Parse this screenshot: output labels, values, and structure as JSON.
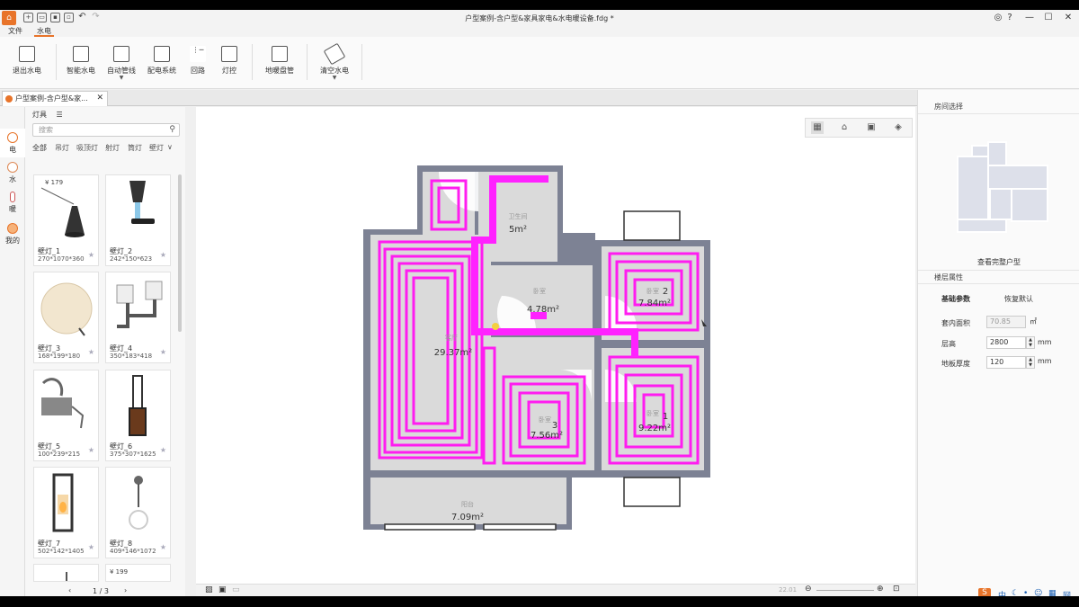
{
  "window": {
    "title": "户型案例-含户型&家具家电&水电暖设备.fdg *",
    "logo": "home-logo-icon",
    "controls": [
      "user-icon",
      "help-icon",
      "minimize-icon",
      "maximize-icon",
      "close-icon"
    ]
  },
  "quick_access": [
    "new-icon",
    "open-icon",
    "save-icon",
    "save-as-icon",
    "undo-icon",
    "redo-icon"
  ],
  "menu": {
    "file": "文件",
    "water_electric": "水电"
  },
  "ribbon": {
    "exit": "退出水电",
    "smart": "智能水电",
    "auto_pipe": "自动管线",
    "distribution": "配电系统",
    "circuit": "回路",
    "light_control": "灯控",
    "floor_heating": "地暖盘管",
    "clear": "清空水电"
  },
  "doc_tab": {
    "label": "户型案例-含户型&家...",
    "close": "✕"
  },
  "vtabs": {
    "electric": "电",
    "water": "水",
    "heating": "暖",
    "mine": "我的"
  },
  "catalog": {
    "header": "灯具",
    "search_placeholder": "搜索",
    "categories": [
      "全部",
      "吊灯",
      "吸顶灯",
      "射灯",
      "筒灯",
      "壁灯"
    ],
    "items": [
      {
        "name": "壁灯_1",
        "size": "270*1070*360",
        "price": "¥ 179"
      },
      {
        "name": "壁灯_2",
        "size": "242*150*623",
        "price": ""
      },
      {
        "name": "壁灯_3",
        "size": "168*199*180",
        "price": ""
      },
      {
        "name": "壁灯_4",
        "size": "350*183*418",
        "price": ""
      },
      {
        "name": "壁灯_5",
        "size": "100*239*215",
        "price": ""
      },
      {
        "name": "壁灯_6",
        "size": "375*307*1625",
        "price": ""
      },
      {
        "name": "壁灯_7",
        "size": "502*142*1405",
        "price": ""
      },
      {
        "name": "壁灯_8",
        "size": "409*146*1072",
        "price": ""
      },
      {
        "name": "",
        "size": "",
        "price": ""
      },
      {
        "name": "",
        "size": "",
        "price": "¥ 199"
      }
    ],
    "pager": "1 / 3"
  },
  "floorplan": {
    "rooms": [
      {
        "label": "卫生间",
        "area": "5m²"
      },
      {
        "label": "卧室",
        "area": "4.78m²"
      },
      {
        "label": "客厅",
        "area": "29.37m²"
      },
      {
        "label": "卧室",
        "area": "7.84m²"
      },
      {
        "label": "卧室",
        "area": "7.56m²"
      },
      {
        "label": "卧室",
        "area": "9.22m²"
      },
      {
        "label": "阳台",
        "area": "7.09m²"
      }
    ],
    "circuit_numbers": [
      "1",
      "2",
      "3"
    ],
    "pipe_color": "#ff1cf0",
    "main_pipe_color": "#ff22ff"
  },
  "view_buttons": [
    "plan-view-icon",
    "room-view-icon",
    "wall-view-icon",
    "3d-view-icon"
  ],
  "status": {
    "zoom_text": "22.01",
    "tools": [
      "hatch-icon",
      "snap-icon",
      "image-icon"
    ]
  },
  "right_panel": {
    "room_select": "房间选择",
    "view_full": "查看完整户型",
    "floor_props": "楼层属性",
    "base_params": "基础参数",
    "restore_default": "恢复默认",
    "inner_area_label": "套内面积",
    "inner_area_value": "70.85",
    "inner_area_unit": "㎡",
    "height_label": "层高",
    "height_value": "2800",
    "height_unit": "mm",
    "floor_thick_label": "地板厚度",
    "floor_thick_value": "120",
    "floor_thick_unit": "mm"
  },
  "tray": [
    "S",
    "中",
    "☾",
    "•",
    "☺",
    "▦",
    "网"
  ]
}
